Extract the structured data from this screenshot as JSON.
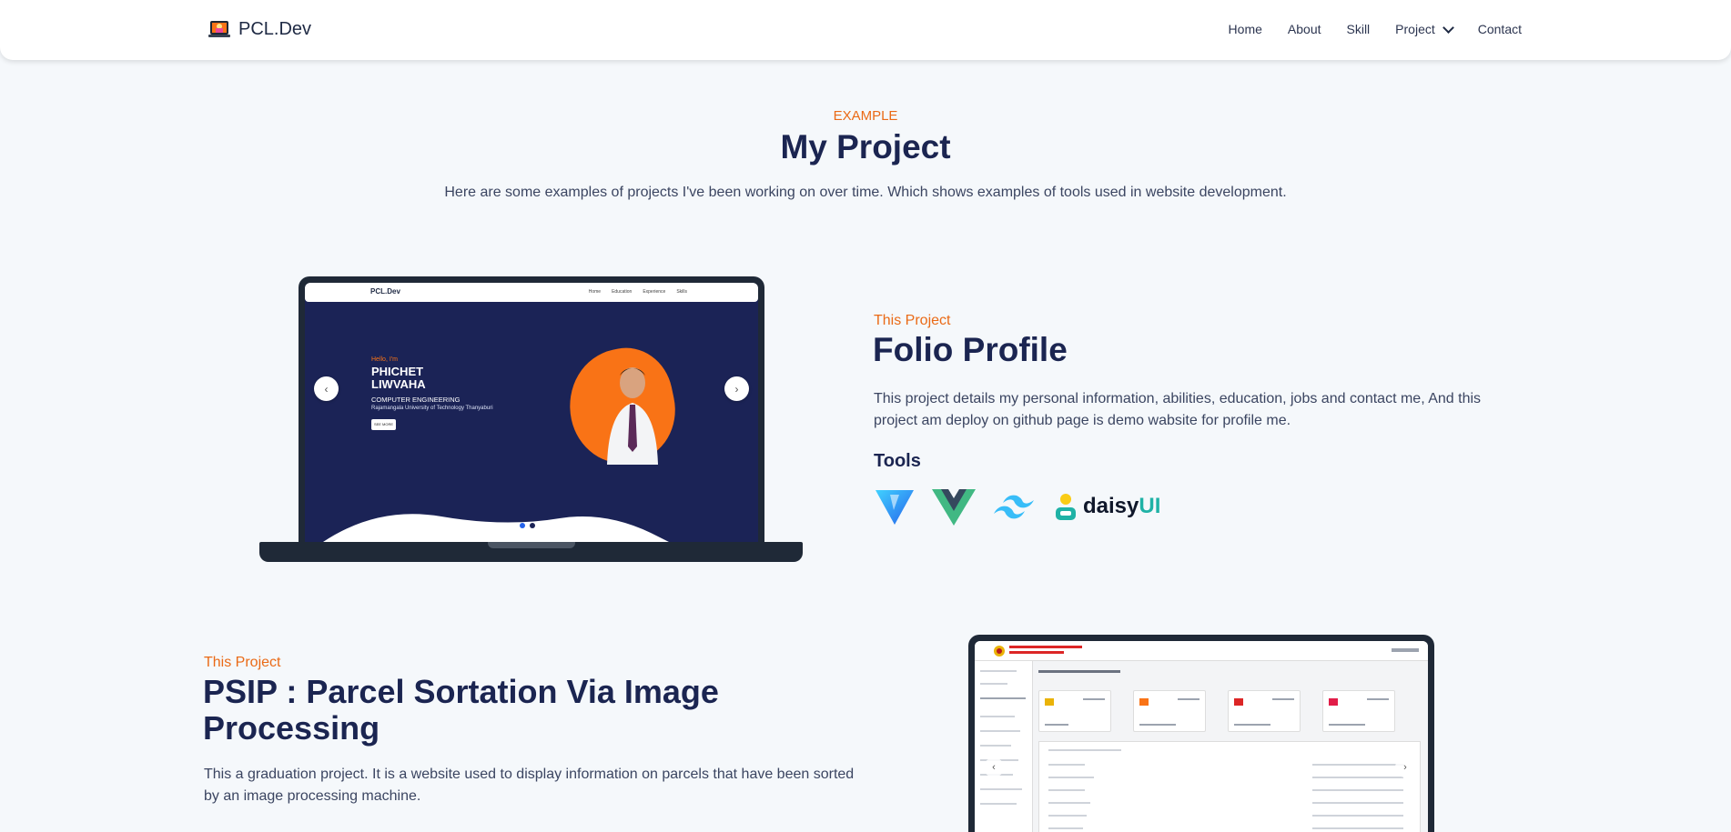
{
  "navbar": {
    "brand": "PCL.Dev",
    "links": [
      "Home",
      "About",
      "Skill",
      "Project",
      "Contact"
    ]
  },
  "header": {
    "eyebrow": "EXAMPLE",
    "title": "My Project",
    "description": "Here are some examples of projects I've been working on over time. Which shows examples of tools used in website development."
  },
  "project1": {
    "eyebrow": "This Project",
    "title": "Folio Profile",
    "description": "This project details my personal information, abilities, education, jobs and contact me, And this project am deploy on github page is demo wabsite for profile me.",
    "tools_heading": "Tools",
    "tools": [
      "vite-icon",
      "vue-icon",
      "tailwind-icon",
      "daisyui-logo"
    ],
    "daisy_text_a": "daisy",
    "daisy_text_b": "UI",
    "preview": {
      "brand": "PCL.Dev",
      "links": [
        "Home",
        "Education",
        "Experience",
        "Skills"
      ],
      "hello": "Hello, I'm",
      "name": "PHICHET LIWVAHA",
      "sub": "COMPUTER ENGINEERING",
      "uni": "Rajamangala University of Technology Thanyaburi",
      "button": "SEE MORE"
    }
  },
  "project2": {
    "eyebrow": "This Project",
    "title": "PSIP : Parcel Sortation Via Image Processing",
    "description": "This a graduation project. It is a website used to display information on parcels that have been sorted by an image processing machine."
  },
  "colors": {
    "accent": "#ea6a16",
    "heading": "#1b2551",
    "background": "#f5f8fb"
  }
}
